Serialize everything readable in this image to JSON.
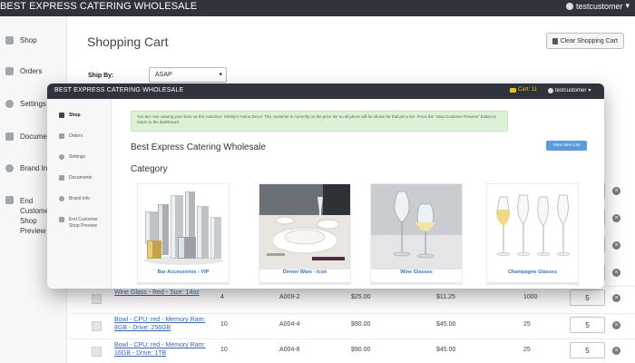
{
  "background": {
    "brand": "BEST EXPRESS CATERING WHOLESALE",
    "user": "testcustomer",
    "sidebar": [
      {
        "label": "Shop",
        "icon": "cart-icon"
      },
      {
        "label": "Orders",
        "icon": "pencil-icon"
      },
      {
        "label": "Settings",
        "icon": "gear-icon"
      },
      {
        "label": "Documents",
        "icon": "document-icon"
      },
      {
        "label": "Brand Info",
        "icon": "info-icon"
      },
      {
        "label": "End Customer Shop Preview",
        "icon": "exit-icon"
      }
    ],
    "page_title": "Shopping Cart",
    "clear_cart_label": "Clear Shopping Cart",
    "ship_by_label": "Ship By:",
    "ship_by_value": "ASAP",
    "rows": [
      {
        "name": "Wine Glass - Red - Size: 14oz",
        "qty": "4",
        "sku": "A009-2",
        "price": "$25.00",
        "sale_price": "$11.25",
        "stock": "1000",
        "cart_qty": "5"
      },
      {
        "name": "Bowl - CPU: red - Memory Ram: 8GB - Drive: 256GB",
        "qty": "10",
        "sku": "A004-4",
        "price": "$90.00",
        "sale_price": "$45.00",
        "stock": "25",
        "cart_qty": "5"
      },
      {
        "name": "Bowl - CPU: red - Memory Ram: 16GB - Drive: 1TB",
        "qty": "10",
        "sku": "A004-8",
        "price": "$90.00",
        "sale_price": "$45.00",
        "stock": "25",
        "cart_qty": "5"
      }
    ]
  },
  "overlay": {
    "brand": "BEST EXPRESS CATERING WHOLESALE",
    "cart_label": "Cart: 11",
    "user": "testcustomer",
    "sidebar": [
      {
        "label": "Shop",
        "icon": "cart-icon"
      },
      {
        "label": "Orders",
        "icon": "pencil-icon"
      },
      {
        "label": "Settings",
        "icon": "gear-icon"
      },
      {
        "label": "Documents",
        "icon": "document-icon"
      },
      {
        "label": "Brand Info",
        "icon": "info-icon"
      },
      {
        "label": "End Customer Shop Preview",
        "icon": "exit-icon"
      }
    ],
    "alert": "You are now viewing your store as the customer: Shelby's Home Decor. This customer is currently on the price tier so all prices will be shown for that price tier. Press the \"Stop Customer Preview\" button to return to the dashboard.",
    "store_title": "Best Express Catering Wholesale",
    "view_item_list": "View Item List",
    "category_heading": "Category",
    "categories": [
      {
        "label": "Bar Accessories - VIP"
      },
      {
        "label": "Dinner Ware - Icon"
      },
      {
        "label": "Wine Glasses"
      },
      {
        "label": "Champagne Glasses"
      }
    ]
  }
}
